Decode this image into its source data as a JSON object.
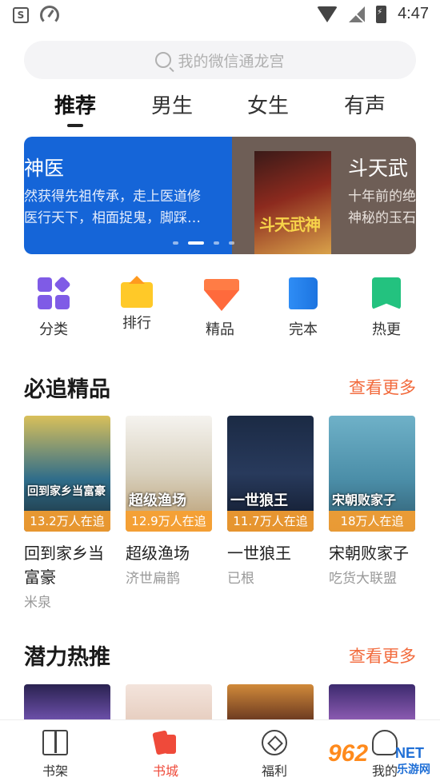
{
  "status_bar": {
    "time": "4:47",
    "app_badge": "S"
  },
  "search": {
    "placeholder": "我的微信通龙宫"
  },
  "tabs": [
    {
      "label": "推荐",
      "active": true
    },
    {
      "label": "男生",
      "active": false
    },
    {
      "label": "女生",
      "active": false
    },
    {
      "label": "有声",
      "active": false
    }
  ],
  "banner": {
    "slides": [
      {
        "title": "神医",
        "desc_line1": "然获得先祖传承，走上医道修",
        "desc_line2": "医行天下，相面捉鬼，脚踩…"
      },
      {
        "title": "斗天武",
        "desc_line1": "十年前的绝",
        "desc_line2": "神秘的玉石",
        "cover_art_text": "斗天武神"
      }
    ],
    "active_dot": 1,
    "dot_count": 4
  },
  "categories": [
    {
      "label": "分类",
      "icon": "category-grid-icon"
    },
    {
      "label": "排行",
      "icon": "ranking-crown-icon"
    },
    {
      "label": "精品",
      "icon": "premium-gem-icon"
    },
    {
      "label": "完本",
      "icon": "completed-book-icon"
    },
    {
      "label": "热更",
      "icon": "hot-update-bookmark-icon"
    }
  ],
  "section_must_read": {
    "title": "必追精品",
    "more_label": "查看更多",
    "books": [
      {
        "title": "回到家乡当富豪",
        "author": "米泉",
        "followers": "13.2万人在追",
        "cover_text": "回到家乡当富豪"
      },
      {
        "title": "超级渔场",
        "author": "济世扁鹊",
        "followers": "12.9万人在追",
        "cover_text": "超级渔场"
      },
      {
        "title": "一世狼王",
        "author": "已根",
        "followers": "11.7万人在追",
        "cover_text": "一世狼王"
      },
      {
        "title": "宋朝败家子",
        "author": "吃货大联盟",
        "followers": "18万人在追",
        "cover_text": "宋朝败家子"
      }
    ]
  },
  "section_hot_picks": {
    "title": "潜力热推",
    "more_label": "查看更多"
  },
  "bottom_nav": [
    {
      "label": "书架",
      "icon": "bookshelf-icon",
      "active": false
    },
    {
      "label": "书城",
      "icon": "bookstore-icon",
      "active": true
    },
    {
      "label": "福利",
      "icon": "welfare-icon",
      "active": false
    },
    {
      "label": "我的",
      "icon": "profile-icon",
      "active": false
    }
  ],
  "watermark": {
    "number": "962",
    "net": "NET",
    "site": "乐游网"
  },
  "colors": {
    "accent": "#f26a3c",
    "nav_active": "#ef4a3a",
    "banner_blue": "#1565d8",
    "badge": "#f8a030"
  }
}
